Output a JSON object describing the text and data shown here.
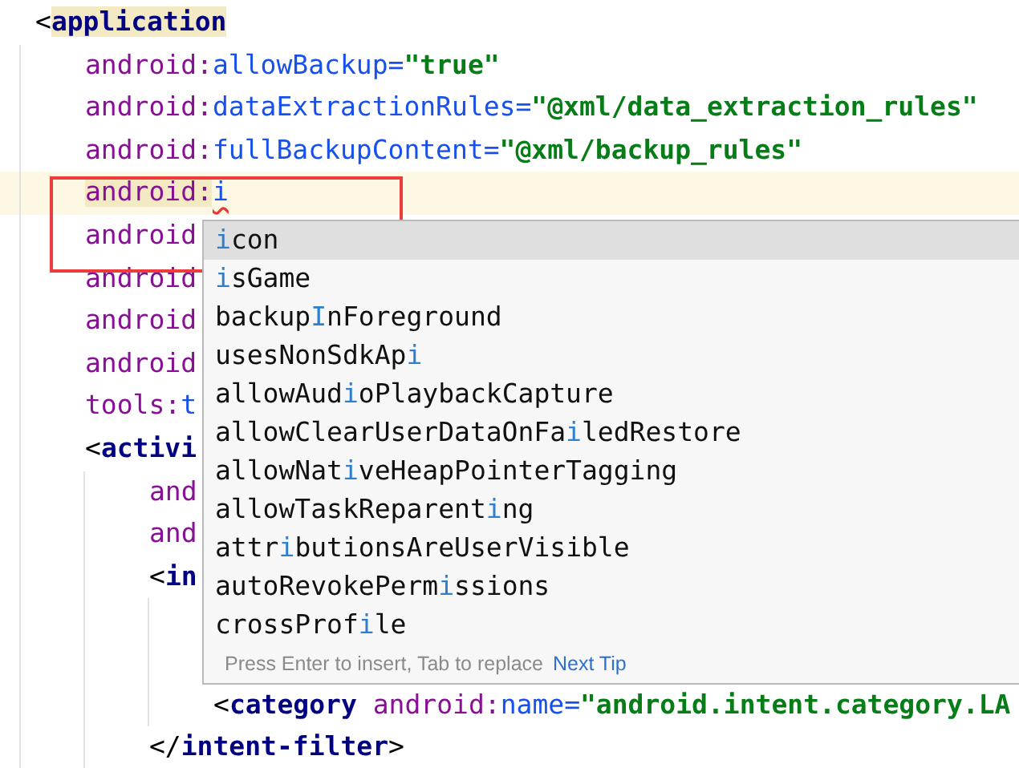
{
  "editor": {
    "lines": [
      {
        "current": false,
        "tokens": [
          {
            "kind": "punct",
            "text": "<",
            "highlighted": false,
            "error": false
          },
          {
            "kind": "tag",
            "text": "application",
            "highlighted": true,
            "error": false
          }
        ],
        "children": [
          {
            "current": false,
            "tokens": [
              {
                "kind": "ns",
                "text": "android:",
                "highlighted": false,
                "error": false
              },
              {
                "kind": "attr",
                "text": "allowBackup=",
                "highlighted": false,
                "error": false
              },
              {
                "kind": "value",
                "text": "\"true\"",
                "highlighted": false,
                "error": false
              }
            ]
          },
          {
            "current": false,
            "tokens": [
              {
                "kind": "ns",
                "text": "android:",
                "highlighted": false,
                "error": false
              },
              {
                "kind": "attr",
                "text": "dataExtractionRules=",
                "highlighted": false,
                "error": false
              },
              {
                "kind": "value",
                "text": "\"@xml/data_extraction_rules\"",
                "highlighted": false,
                "error": false
              }
            ]
          },
          {
            "current": false,
            "tokens": [
              {
                "kind": "ns",
                "text": "android:",
                "highlighted": false,
                "error": false
              },
              {
                "kind": "attr",
                "text": "fullBackupContent=",
                "highlighted": false,
                "error": false
              },
              {
                "kind": "value",
                "text": "\"@xml/backup_rules\"",
                "highlighted": false,
                "error": false
              }
            ]
          },
          {
            "current": true,
            "tokens": [
              {
                "kind": "ns",
                "text": "android:",
                "highlighted": true,
                "error": false
              },
              {
                "kind": "attr",
                "text": "i",
                "highlighted": false,
                "error": true
              }
            ]
          },
          {
            "current": false,
            "tokens": [
              {
                "kind": "ns",
                "text": "android",
                "highlighted": false,
                "error": false
              }
            ]
          },
          {
            "current": false,
            "tokens": [
              {
                "kind": "ns",
                "text": "android",
                "highlighted": false,
                "error": false
              }
            ]
          },
          {
            "current": false,
            "tokens": [
              {
                "kind": "ns",
                "text": "android",
                "highlighted": false,
                "error": false
              }
            ]
          },
          {
            "current": false,
            "tokens": [
              {
                "kind": "ns",
                "text": "android",
                "highlighted": false,
                "error": false
              }
            ]
          },
          {
            "current": false,
            "tokens": [
              {
                "kind": "ns",
                "text": "tools:",
                "highlighted": false,
                "error": false
              },
              {
                "kind": "attr",
                "text": "t",
                "highlighted": false,
                "error": false
              }
            ]
          },
          {
            "current": false,
            "tokens": [
              {
                "kind": "punct",
                "text": "<",
                "highlighted": false,
                "error": false
              },
              {
                "kind": "tag",
                "text": "activi",
                "highlighted": false,
                "error": false
              }
            ],
            "children": [
              {
                "current": false,
                "tokens": [
                  {
                    "kind": "ns",
                    "text": "and",
                    "highlighted": false,
                    "error": false
                  }
                ]
              },
              {
                "current": false,
                "tokens": [
                  {
                    "kind": "ns",
                    "text": "and",
                    "highlighted": false,
                    "error": false
                  }
                ]
              },
              {
                "current": false,
                "tokens": [
                  {
                    "kind": "punct",
                    "text": "<",
                    "highlighted": false,
                    "error": false
                  },
                  {
                    "kind": "tag",
                    "text": "in",
                    "highlighted": false,
                    "error": false
                  }
                ],
                "children": [
                  {
                    "current": false,
                    "tokens": [
                      {
                        "kind": "punct",
                        "text": "<",
                        "highlighted": false,
                        "error": false
                      },
                      {
                        "kind": "tag",
                        "text": "category ",
                        "highlighted": false,
                        "error": false
                      },
                      {
                        "kind": "ns",
                        "text": "android:",
                        "highlighted": false,
                        "error": false
                      },
                      {
                        "kind": "attr",
                        "text": "name=",
                        "highlighted": false,
                        "error": false
                      },
                      {
                        "kind": "value",
                        "text": "\"android.intent.category.LA",
                        "highlighted": false,
                        "error": false
                      }
                    ]
                  }
                ]
              },
              {
                "current": false,
                "tokens": [
                  {
                    "kind": "punct",
                    "text": "</",
                    "highlighted": false,
                    "error": false
                  },
                  {
                    "kind": "tag",
                    "text": "intent-filter",
                    "highlighted": false,
                    "error": false
                  },
                  {
                    "kind": "punct",
                    "text": ">",
                    "highlighted": false,
                    "error": false
                  }
                ]
              }
            ]
          }
        ]
      }
    ]
  },
  "completion_popup": {
    "items": [
      {
        "selected": true,
        "match": "i",
        "post": "con"
      },
      {
        "selected": false,
        "match": "i",
        "post": "sGame"
      },
      {
        "selected": false,
        "pre": "backup",
        "match": "I",
        "post": "nForeground"
      },
      {
        "selected": false,
        "pre": "usesNonSdkAp",
        "match": "i"
      },
      {
        "selected": false,
        "pre": "allowAud",
        "match": "i",
        "post": "oPlaybackCapture"
      },
      {
        "selected": false,
        "pre": "allowClearUserDataOnFa",
        "match": "i",
        "post": "ledRestore"
      },
      {
        "selected": false,
        "pre": "allowNat",
        "match": "i",
        "post": "veHeapPointerTagging"
      },
      {
        "selected": false,
        "pre": "allowTaskReparent",
        "match": "i",
        "post": "ng"
      },
      {
        "selected": false,
        "pre": "attr",
        "match": "i",
        "post": "butionsAreUserVisible"
      },
      {
        "selected": false,
        "pre": "autoRevokePerm",
        "match": "i",
        "post": "ssions"
      },
      {
        "selected": false,
        "pre": "crossProf",
        "match": "i",
        "post": "le"
      }
    ],
    "hint": "Press Enter to insert, Tab to replace",
    "tip_link": "Next Tip"
  }
}
